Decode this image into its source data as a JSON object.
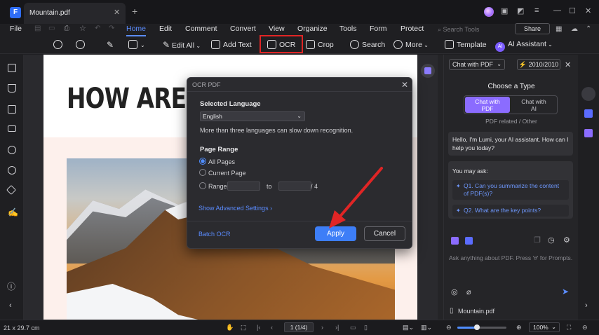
{
  "titlebar": {
    "tab_name": "Mountain.pdf",
    "close": "✕",
    "new_tab": "+"
  },
  "menu": {
    "file": "File",
    "home": "Home",
    "edit": "Edit",
    "comment": "Comment",
    "convert": "Convert",
    "view": "View",
    "organize": "Organize",
    "tools": "Tools",
    "form": "Form",
    "protect": "Protect",
    "search_placeholder": "Search Tools",
    "share": "Share"
  },
  "toolbar": {
    "edit_all": "Edit All",
    "add_text": "Add Text",
    "ocr": "OCR",
    "crop": "Crop",
    "search": "Search",
    "more": "More",
    "template": "Template",
    "ai_assistant": "AI Assistant",
    "ai_badge": "AI"
  },
  "document": {
    "heading": "HOW ARE M"
  },
  "ocr_dialog": {
    "title": "OCR PDF",
    "selected_language_label": "Selected Language",
    "language": "English",
    "language_hint": "More than three languages can slow down recognition.",
    "page_range_label": "Page Range",
    "all_pages": "All Pages",
    "current_page": "Current Page",
    "range": "Range",
    "range_to": "to",
    "range_total": "/ 4",
    "advanced": "Show Advanced Settings",
    "batch_ocr": "Batch OCR",
    "apply": "Apply",
    "cancel": "Cancel"
  },
  "ai_panel": {
    "mode": "Chat with PDF",
    "credits": "2010/2010",
    "choose_type": "Choose a Type",
    "type_pdf_line1": "Chat with",
    "type_pdf_line2": "PDF",
    "type_ai_line1": "Chat with",
    "type_ai_line2": "AI",
    "pdf_related": "PDF related / Other",
    "greeting": "Hello, I'm Lumi, your AI assistant. How can I help you today?",
    "you_may_ask": "You may ask:",
    "q1": "Q1. Can you summarize the content of PDF(s)?",
    "q2": "Q2. What are the key points?",
    "ask_placeholder": "Ask anything about PDF. Press '#' for Prompts.",
    "file_name": "Mountain.pdf"
  },
  "status": {
    "dimensions": "21 x 29.7 cm",
    "page": "1 (1/4)",
    "zoom": "100%"
  },
  "colors": {
    "accent": "#3d7ef7",
    "highlight": "#e02525",
    "ai_purple": "#8b6cff"
  }
}
